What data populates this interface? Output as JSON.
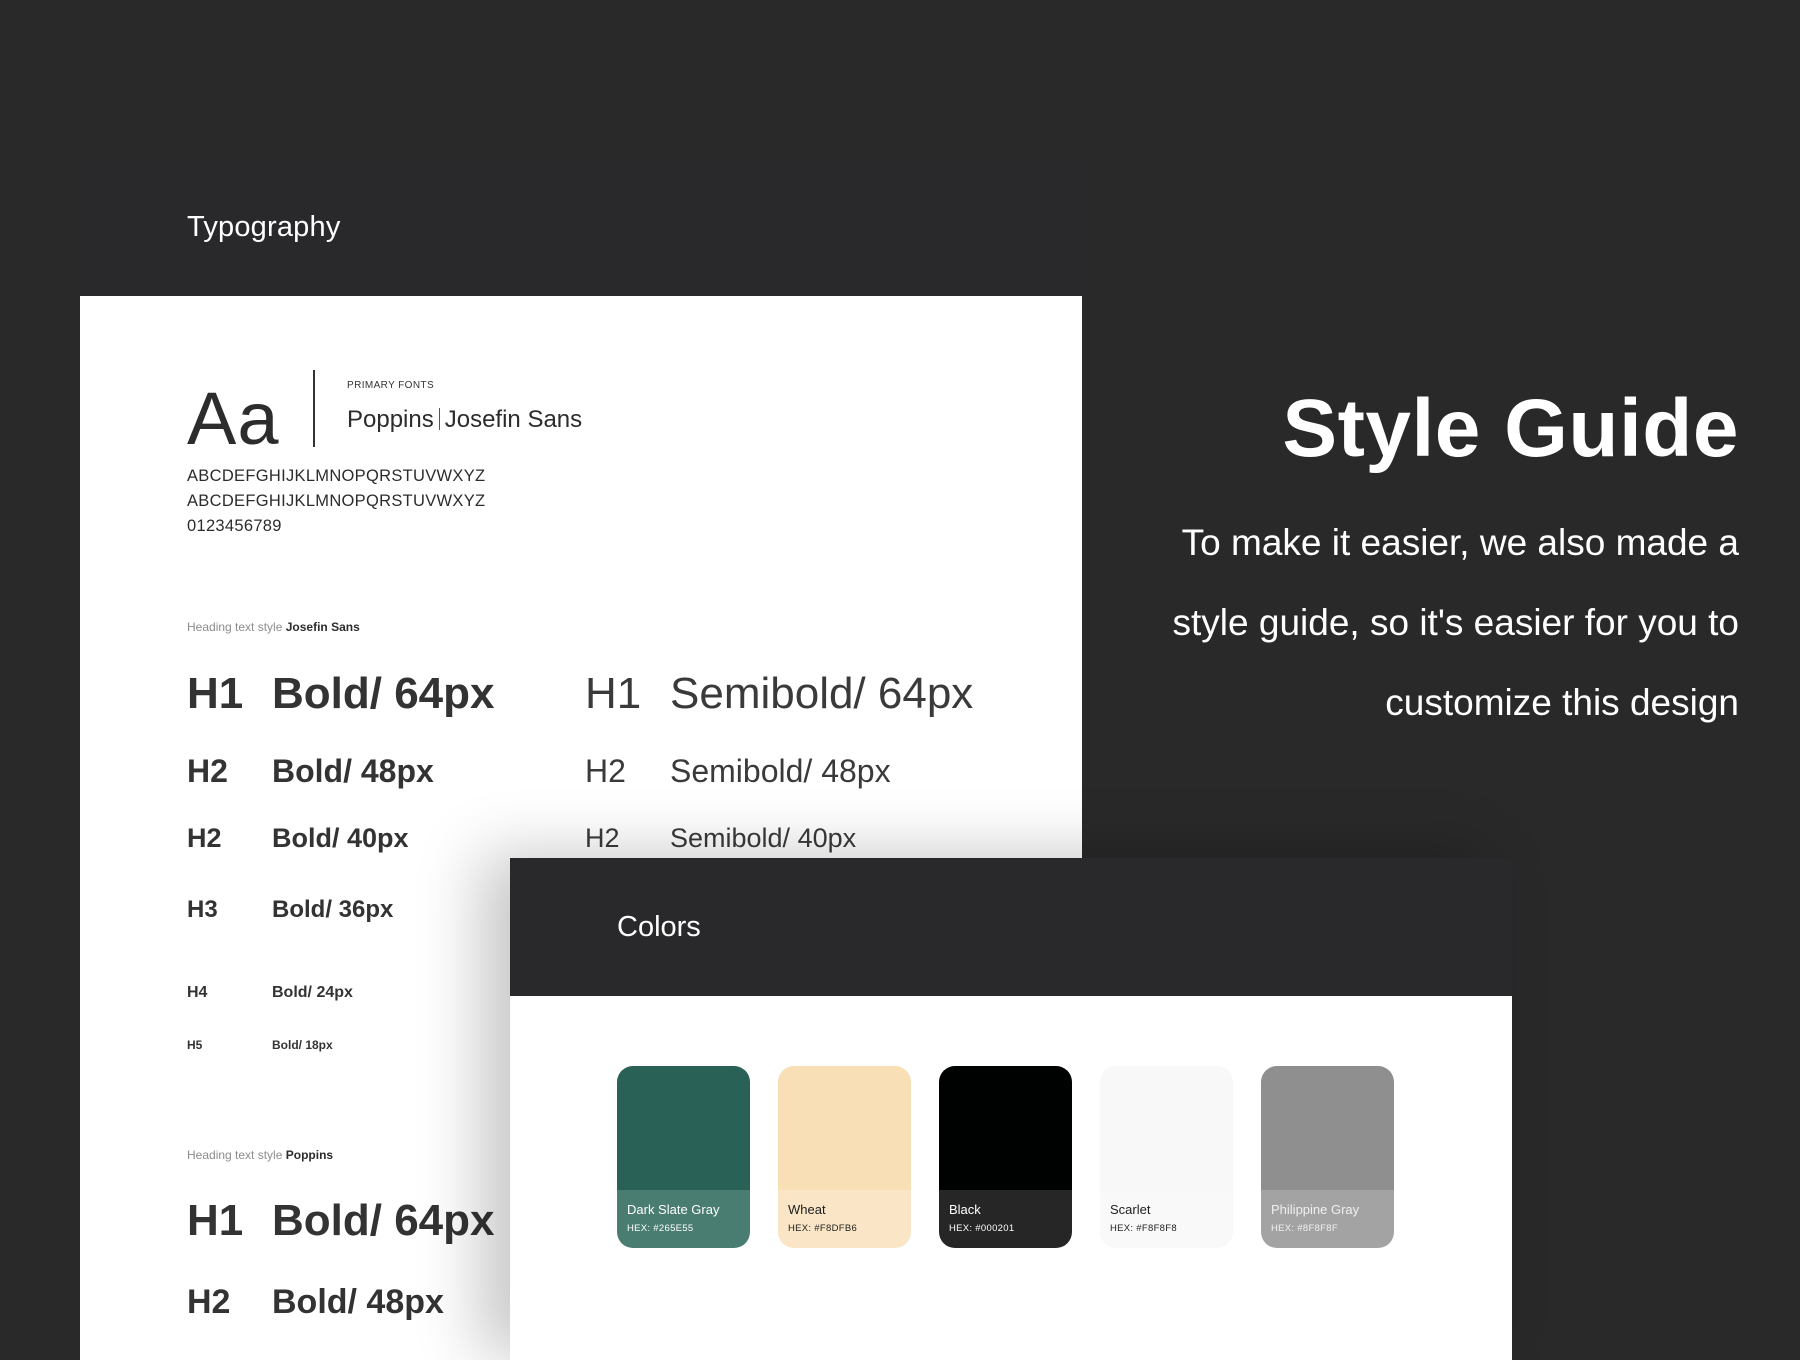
{
  "typography": {
    "title": "Typography",
    "sample_glyph": "Aa",
    "primary_fonts_label": "PRIMARY FONTS",
    "font_one": "Poppins",
    "font_two": "Josefin Sans",
    "uppercase_line_1": "ABCDEFGHIJKLMNOPQRSTUVWXYZ",
    "uppercase_line_2": "ABCDEFGHIJKLMNOPQRSTUVWXYZ",
    "digits": "0123456789",
    "josefin_section": {
      "caption_prefix": "Heading text style",
      "caption_font": "Josefin Sans",
      "bold_rows": [
        {
          "tag": "H1",
          "desc": "Bold/ 64px"
        },
        {
          "tag": "H2",
          "desc": "Bold/ 48px"
        },
        {
          "tag": "H2",
          "desc": "Bold/ 40px"
        },
        {
          "tag": "H3",
          "desc": "Bold/ 36px"
        },
        {
          "tag": "H4",
          "desc": "Bold/ 24px"
        },
        {
          "tag": "H5",
          "desc": "Bold/ 18px"
        }
      ],
      "semibold_rows": [
        {
          "tag": "H1",
          "desc": "Semibold/ 64px"
        },
        {
          "tag": "H2",
          "desc": "Semibold/ 48px"
        },
        {
          "tag": "H2",
          "desc": "Semibold/ 40px"
        }
      ]
    },
    "poppins_section": {
      "caption_prefix": "Heading text style",
      "caption_font": "Poppins",
      "bold_rows": [
        {
          "tag": "H1",
          "desc": "Bold/ 64px"
        },
        {
          "tag": "H2",
          "desc": "Bold/ 48px"
        }
      ]
    }
  },
  "colors": {
    "title": "Colors",
    "swatches": [
      {
        "name": "Dark Slate Gray",
        "hex_label": "HEX: #265E55",
        "color": "#2a6156",
        "bottom": "#4a7d71",
        "text": "#ffffff"
      },
      {
        "name": "Wheat",
        "hex_label": "HEX: #F8DFB6",
        "color": "#f8dfb6",
        "bottom": "#fae6c6",
        "text": "#1e1e1e"
      },
      {
        "name": "Black",
        "hex_label": "HEX: #000201",
        "color": "#000201",
        "bottom": "#262626",
        "text": "#ffffff"
      },
      {
        "name": "Scarlet",
        "hex_label": "HEX: #F8F8F8",
        "color": "#f8f8f8",
        "bottom": "#f9f9f9",
        "text": "#1e1e1e"
      },
      {
        "name": "Philippine Gray",
        "hex_label": "HEX: #8F8F8F",
        "color": "#8f8f8f",
        "bottom": "#a3a3a3",
        "text": "#f0f0f0"
      }
    ]
  },
  "hero": {
    "title": "Style Guide",
    "body_line_1": "To make it easier, we also made a",
    "body_line_2": "style guide, so it's easier for you to",
    "body_line_3": "customize this design"
  }
}
